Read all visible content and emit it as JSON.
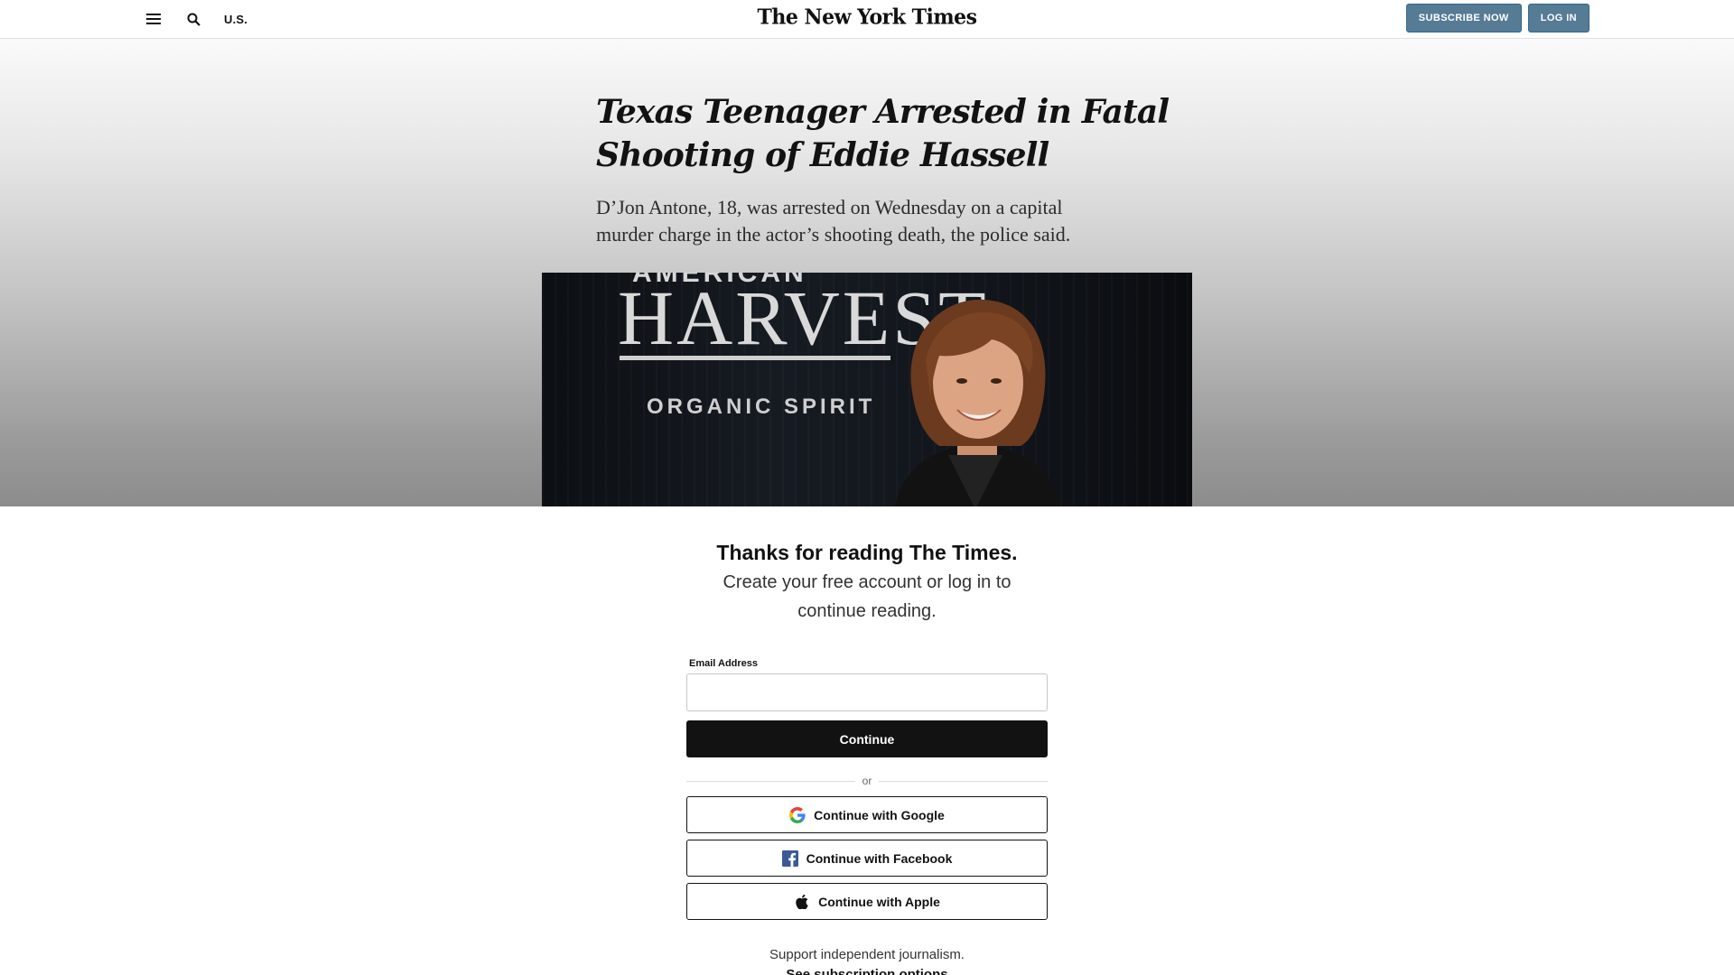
{
  "header": {
    "section_label": "U.S.",
    "logo_text": "The New York Times",
    "subscribe_label": "SUBSCRIBE NOW",
    "login_label": "LOG IN"
  },
  "article": {
    "headline": "Texas Teenager Arrested in Fatal Shooting of Eddie Hassell",
    "summary": "D’Jon Antone, 18, was arrested on Wednesday on a capital murder charge in the actor’s shooting death, the police said.",
    "photo": {
      "backdrop_top": "AMERICAN",
      "backdrop_main": "HARVEST",
      "backdrop_sub": "ORGANIC SPIRIT"
    }
  },
  "regwall": {
    "title": "Thanks for reading The Times.",
    "subtitle": "Create your free account or log in to continue reading.",
    "email_label": "Email Address",
    "email_value": "",
    "continue_label": "Continue",
    "divider_text": "or",
    "google_label": "Continue with Google",
    "facebook_label": "Continue with Facebook",
    "apple_label": "Continue with Apple",
    "support_text": "Support independent journalism.",
    "subscription_link": "See subscription options"
  },
  "colors": {
    "header_button_bg": "#567b95",
    "continue_bg": "#121212",
    "facebook_blue": "#3b5998"
  },
  "icons": {
    "menu": "hamburger-icon",
    "search": "search-icon",
    "google": "google-icon",
    "facebook": "facebook-icon",
    "apple": "apple-icon"
  }
}
